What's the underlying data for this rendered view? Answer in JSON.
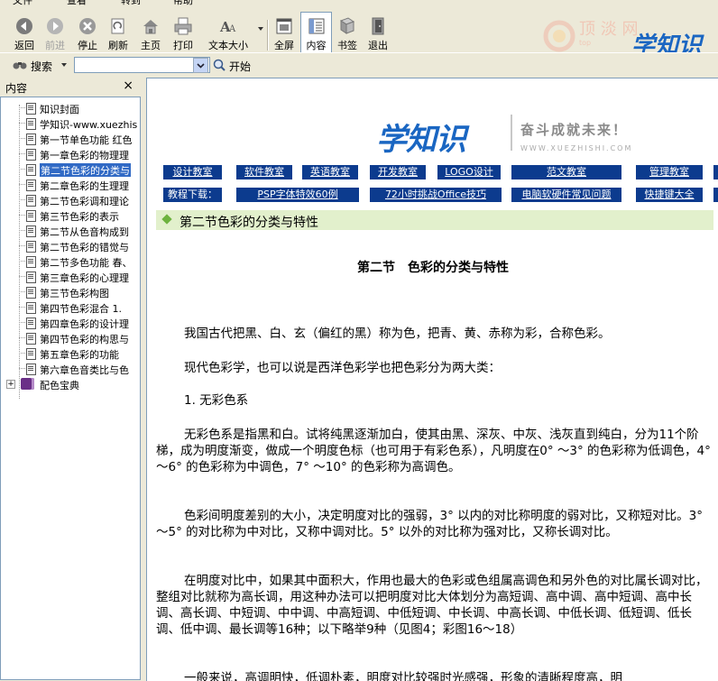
{
  "menubar": {
    "items": [
      "文件",
      "查看",
      "转到",
      "帮助"
    ]
  },
  "toolbar": {
    "buttons": [
      {
        "label": "返回",
        "icon": "back-icon"
      },
      {
        "label": "前进",
        "icon": "forward-icon"
      },
      {
        "label": "停止",
        "icon": "stop-icon"
      },
      {
        "label": "刷新",
        "icon": "refresh-icon"
      },
      {
        "label": "主页",
        "icon": "home-icon"
      },
      {
        "label": "打印",
        "icon": "print-icon"
      },
      {
        "label": "文本大小",
        "icon": "font-size-icon"
      },
      {
        "label": "全屏",
        "icon": "fullscreen-icon"
      },
      {
        "label": "内容",
        "icon": "contents-icon"
      },
      {
        "label": "书签",
        "icon": "bookmark-icon"
      },
      {
        "label": "退出",
        "icon": "exit-icon"
      }
    ],
    "brand": "学知识"
  },
  "search": {
    "label": "搜索",
    "value": "",
    "go_label": "开始"
  },
  "sidebar": {
    "title": "内容",
    "close": "×",
    "items": [
      "知识封面",
      "学知识-www.xuezhis",
      "第一节单色功能 红色",
      "第一章色彩的物理理",
      "第二节色彩的分类与",
      "第二章色彩的生理理",
      "第二节色彩调和理论",
      "第三节色彩的表示",
      "第二节从色音构成到",
      "第二节色彩的错觉与",
      "第二节多色功能 春、",
      "第三章色彩的心理理",
      "第三节色彩构图",
      "第四节色彩混合 1.",
      "第四章色彩的设计理",
      "第四节色彩的构思与",
      "第五章色彩的功能",
      "第六章色音类比与色",
      "配色宝典"
    ],
    "selected_index": 4
  },
  "site": {
    "logo": "学知识",
    "slogan": "奋斗成就未来！",
    "url": "WWW.XUEZHISHI.COM",
    "nav_row1": [
      "设计教室",
      "软件教室",
      "英语教室",
      "开发教室",
      "LOGO设计",
      "范文教室",
      "管理教室"
    ],
    "nav_row2_label": "教程下载：",
    "nav_row2": [
      "PSP字体特效60例",
      "72小时挑战Office技巧",
      "电脑软硬件常见问题",
      "快捷键大全"
    ]
  },
  "article": {
    "section_title": "第二节色彩的分类与特性",
    "title": "第二节　色彩的分类与特性",
    "paragraphs": [
      "我国古代把黑、白、玄（偏红的黑）称为色，把青、黄、赤称为彩，合称色彩。",
      "现代色彩学，也可以说是西洋色彩学也把色彩分为两大类：",
      "1. 无彩色系",
      "无彩色系是指黑和白。试将纯黑逐渐加白，使其由黑、深灰、中灰、浅灰直到纯白，分为11个阶梯，成为明度渐变，做成一个明度色标（也可用于有彩色系），凡明度在0° ～3° 的色彩称为低调色，4° ～6° 的色彩称为中调色，7° ～10° 的色彩称为高调色。",
      "色彩间明度差别的大小，决定明度对比的强弱，3° 以内的对比称明度的弱对比，又称短对比。3° ～5° 的对比称为中对比，又称中调对比。5° 以外的对比称为强对比，又称长调对比。",
      "在明度对比中，如果其中面积大，作用也最大的色彩或色组属高调色和另外色的对比属长调对比，整组对比就称为高长调，用这种办法可以把明度对比大体划分为高短调、高中调、高中短调、高中长调、高长调、中短调、中中调、中高短调、中低短调、中长调、中高长调、中低长调、低短调、低长调、低中调、最长调等16种；以下略举9种（见图4；彩图16～18）",
      "一般来说，高调明快，低调朴素，明度对比较强时光感强，形象的清晰程度高，明"
    ]
  }
}
